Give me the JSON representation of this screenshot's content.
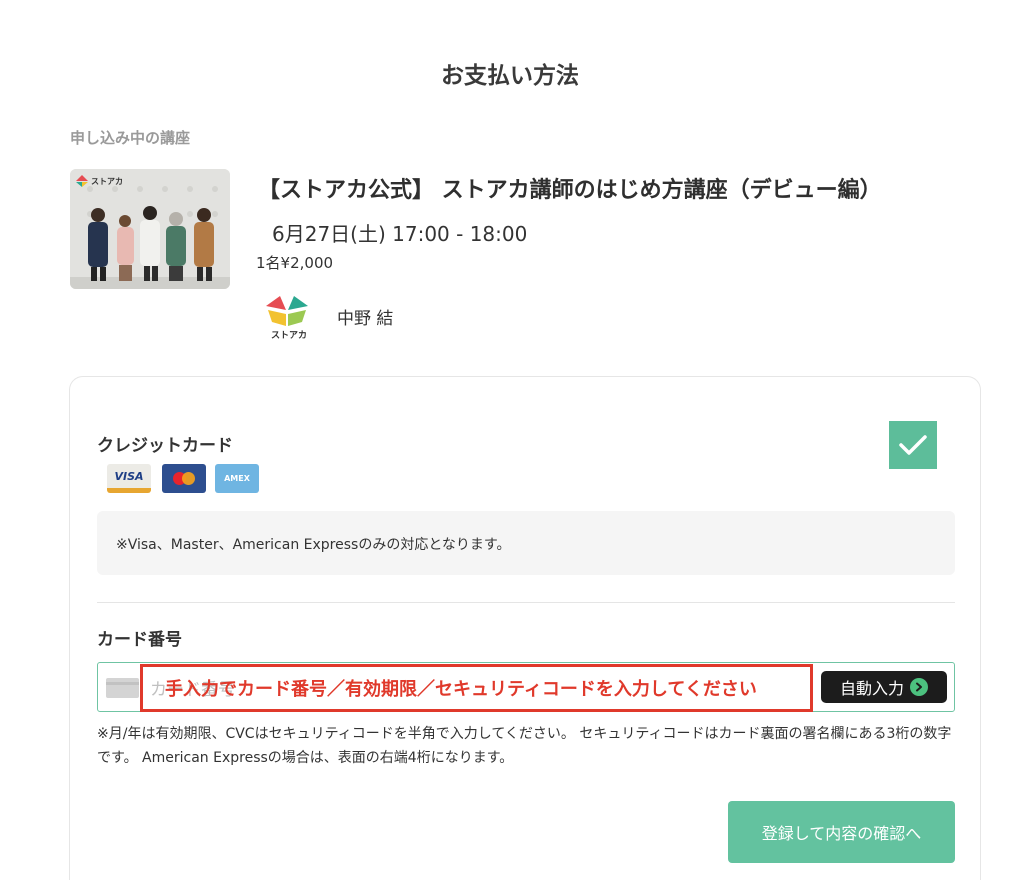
{
  "page": {
    "title": "お支払い方法",
    "section_label": "申し込み中の講座"
  },
  "course": {
    "title": "【ストアカ公式】 ストアカ講師のはじめ方講座（デビュー編）",
    "datetime": "6月27日(土) 17:00 - 18:00",
    "price": "1名¥2,000",
    "organizer_name": "中野 結",
    "thumbnail_logo_text": "ストアカ",
    "org_logo_text": "ストアカ"
  },
  "payment": {
    "method_label": "クレジットカード",
    "selected": true,
    "brands": {
      "visa": "VISA",
      "amex": "AMEX"
    },
    "notice": "※Visa、Master、American Expressのみの対応となります。",
    "card_number_label": "カード番号",
    "card_number_placeholder": "カード番号",
    "overlay_message": "手入力でカード番号／有効期限／セキュリティコードを入力してください",
    "autofill_label": "自動入力",
    "help_text": "※月/年は有効期限、CVCはセキュリティコードを半角で入力してください。 セキュリティコードはカード裏面の署名欄にある3桁の数字です。 American Expressの場合は、表面の右端4桁になります。",
    "submit_label": "登録して内容の確認へ"
  },
  "colors": {
    "accent_green": "#5dbd9a",
    "submit_green": "#63c29f",
    "input_border": "#6fc4a3",
    "alert_red": "#e0392b"
  }
}
